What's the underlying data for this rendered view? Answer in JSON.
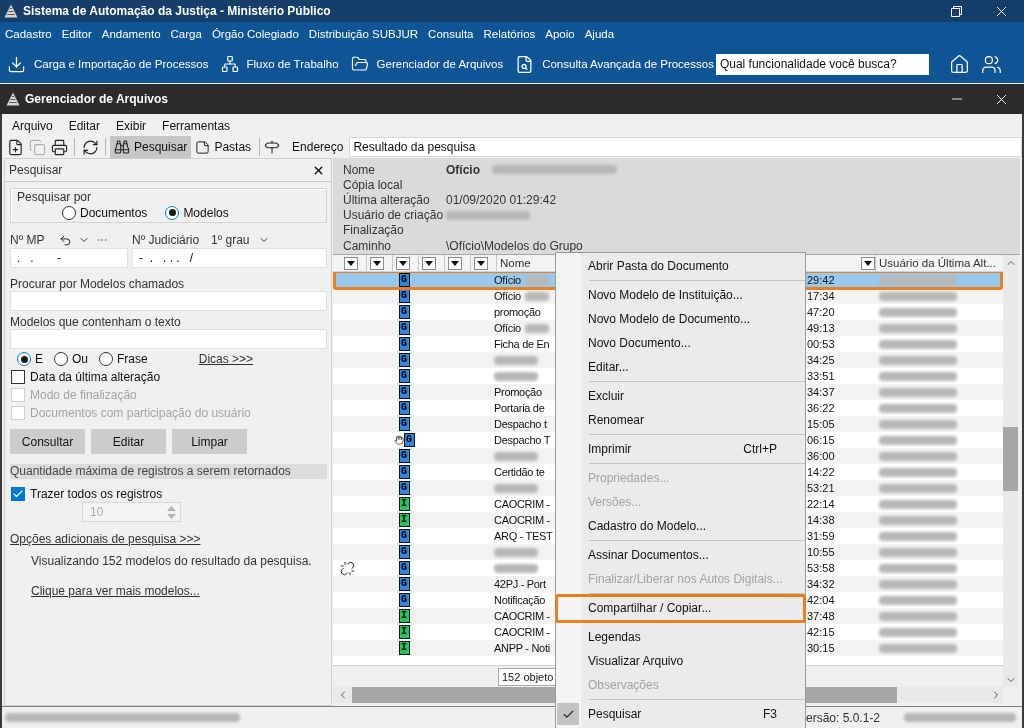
{
  "window": {
    "title": "Sistema de Automação da Justiça - Ministério Público"
  },
  "main_menu": [
    "Cadastro",
    "Editor",
    "Andamento",
    "Carga",
    "Órgão Colegiado",
    "Distribuição SUBJUR",
    "Consulta",
    "Relatórios",
    "Apoio",
    "Ajuda"
  ],
  "toolbar": {
    "items": [
      {
        "kind": "import",
        "label": "Carga e Importação de Processos"
      },
      {
        "kind": "workflow",
        "label": "Fluxo de Trabalho"
      },
      {
        "kind": "files",
        "label": "Gerenciador de Arquivos"
      },
      {
        "kind": "search",
        "label": "Consulta Avançada de Processos"
      }
    ],
    "search": {
      "placeholder": "Qual funcionalidade você busca?"
    }
  },
  "file_manager": {
    "title": "Gerenciador de Arquivos",
    "menu": [
      "Arquivo",
      "Editar",
      "Exibir",
      "Ferramentas"
    ],
    "toolbar": {
      "buttons": [
        {
          "kind": "new",
          "disabled": false
        },
        {
          "kind": "copy",
          "disabled": true
        },
        {
          "kind": "print",
          "disabled": false
        },
        {
          "kind": "refresh",
          "disabled": false
        }
      ],
      "tabs": [
        {
          "kind": "search",
          "label": "Pesquisar",
          "selected": true
        },
        {
          "kind": "folders",
          "label": "Pastas",
          "selected": false
        }
      ],
      "address_label": "Endereço",
      "address": "Resultado da pesquisa"
    }
  },
  "search_panel": {
    "title": "Pesquisar",
    "search_by": {
      "label": "Pesquisar por",
      "options": [
        {
          "label": "Documentos",
          "selected": false
        },
        {
          "label": "Modelos",
          "selected": true
        }
      ]
    },
    "mp": {
      "label": "Nº MP",
      "value": ".   .       -"
    },
    "judicial": {
      "label": "Nº Judiciário",
      "degree": "1º grau",
      "value": "-  .   . . .   /"
    },
    "name_query": {
      "label": "Procurar por Modelos chamados"
    },
    "text_query": {
      "label": "Modelos que contenham o texto"
    },
    "match": [
      {
        "label": "E",
        "selected": true
      },
      {
        "label": "Ou",
        "selected": false
      },
      {
        "label": "Frase",
        "selected": false
      }
    ],
    "tips_link": "Dicas >>>",
    "filters": [
      {
        "label": "Data da última alteração",
        "checked": false,
        "disabled": false
      },
      {
        "label": "Modo de finalização",
        "checked": false,
        "disabled": true
      },
      {
        "label": "Documentos com participação do usuário",
        "checked": false,
        "disabled": true
      }
    ],
    "buttons": [
      "Consultar",
      "Editar",
      "Limpar"
    ],
    "limit_heading": "Quantidade máxima de registros a serem retornados",
    "fetch_all": {
      "label": "Trazer todos os registros",
      "checked": true
    },
    "limit": {
      "value": "10",
      "disabled": true
    },
    "more_options_link": "Opções adicionais de pesquisa >>>",
    "summary": "Visualizando 152 modelos do resultado da pesquisa.",
    "more_link": "Clique para ver mais modelos..."
  },
  "details": [
    {
      "kind": "title",
      "label": "Nome",
      "value": "Ofício",
      "redacted": true
    },
    {
      "kind": "field",
      "label": "Cópia local",
      "redacted": false
    },
    {
      "kind": "field",
      "label": "Última alteração",
      "value": "01/09/2020 01:29:42",
      "redacted": false
    },
    {
      "kind": "field",
      "label": "Usuário de criação",
      "redacted": true
    },
    {
      "kind": "field",
      "label": "Finalização",
      "redacted": false
    },
    {
      "kind": "field",
      "label": "Caminho",
      "value": "\\Ofício\\Modelos do Grupo",
      "redacted": false
    }
  ],
  "table": {
    "columns": [
      {
        "label": "Nome"
      },
      {
        "label": "Usuário da Última Alt..."
      }
    ],
    "user_redacted": true,
    "rows": [
      {
        "kind": "plain",
        "badge": "G",
        "color": "#2f86dd",
        "name": "Ofício",
        "name_redacted": true,
        "time": "29:42",
        "selected": true,
        "highlighted": true
      },
      {
        "kind": "plain",
        "badge": "G",
        "color": "#2f86dd",
        "name": "Ofício",
        "name_redacted": true,
        "time": "17:34",
        "selected": false,
        "highlighted": false
      },
      {
        "kind": "plain",
        "badge": "G",
        "color": "#2f86dd",
        "name": "promoção",
        "name_redacted": false,
        "time": "47:20",
        "selected": false,
        "highlighted": false
      },
      {
        "kind": "plain",
        "badge": "G",
        "color": "#2f86dd",
        "name": "Ofício",
        "name_redacted": true,
        "time": "49:13",
        "selected": false,
        "highlighted": false
      },
      {
        "kind": "plain",
        "badge": "G",
        "color": "#2f86dd",
        "name": "Ficha de En",
        "name_redacted": false,
        "time": "00:53",
        "selected": false,
        "highlighted": false
      },
      {
        "kind": "plain",
        "badge": "G",
        "color": "#2f86dd",
        "name_redacted": true,
        "time": "34:25",
        "selected": false,
        "highlighted": false
      },
      {
        "kind": "plain",
        "badge": "G",
        "color": "#2f86dd",
        "name_redacted": true,
        "time": "33:51",
        "selected": false,
        "highlighted": false
      },
      {
        "kind": "plain",
        "badge": "G",
        "color": "#2f86dd",
        "name": "Promoção",
        "name_redacted": false,
        "time": "34:37",
        "selected": false,
        "highlighted": false
      },
      {
        "kind": "plain",
        "badge": "G",
        "color": "#2f86dd",
        "name": "Portaria de",
        "name_redacted": false,
        "time": "36:22",
        "selected": false,
        "highlighted": false
      },
      {
        "kind": "plain",
        "badge": "G",
        "color": "#2f86dd",
        "name": "Despacho t",
        "name_redacted": false,
        "time": "15:05",
        "selected": false,
        "highlighted": false
      },
      {
        "kind": "shared",
        "badge": "G",
        "color": "#2f86dd",
        "name": "Despacho T",
        "name_redacted": false,
        "time": "06:15",
        "selected": false,
        "highlighted": false
      },
      {
        "kind": "plain",
        "badge": "G",
        "color": "#2f86dd",
        "name_redacted": true,
        "time": "36:00",
        "selected": false,
        "highlighted": false
      },
      {
        "kind": "plain",
        "badge": "G",
        "color": "#2f86dd",
        "name": "Certidão te",
        "name_redacted": false,
        "time": "14:22",
        "selected": false,
        "highlighted": false
      },
      {
        "kind": "plain",
        "badge": "G",
        "color": "#2f86dd",
        "name_redacted": true,
        "time": "53:21",
        "selected": false,
        "highlighted": false
      },
      {
        "kind": "plain",
        "badge": "I",
        "color": "#22c55e",
        "name": "CAOCRIM -",
        "name_redacted": false,
        "time": "22:14",
        "selected": false,
        "highlighted": false
      },
      {
        "kind": "plain",
        "badge": "I",
        "color": "#22c55e",
        "name": "CAOCRIM -",
        "name_redacted": false,
        "time": "14:38",
        "selected": false,
        "highlighted": false
      },
      {
        "kind": "plain",
        "badge": "G",
        "color": "#2f86dd",
        "name": "ARQ - TEST",
        "name_redacted": false,
        "time": "31:59",
        "selected": false,
        "highlighted": false
      },
      {
        "kind": "plain",
        "badge": "G",
        "color": "#2f86dd",
        "name_redacted": true,
        "time": "10:55",
        "selected": false,
        "highlighted": false
      },
      {
        "kind": "linked",
        "badge": "G",
        "color": "#2f86dd",
        "name_redacted": true,
        "time": "53:58",
        "selected": false,
        "highlighted": false
      },
      {
        "kind": "plain",
        "badge": "G",
        "color": "#2f86dd",
        "name": "42PJ - Port",
        "name_redacted": false,
        "time": "34:32",
        "selected": false,
        "highlighted": false
      },
      {
        "kind": "plain",
        "badge": "G",
        "color": "#2f86dd",
        "name": "Notificação",
        "name_redacted": false,
        "time": "42:04",
        "selected": false,
        "highlighted": false
      },
      {
        "kind": "plain",
        "badge": "I",
        "color": "#22c55e",
        "name": "CAOCRIM -",
        "name_redacted": false,
        "time": "37:48",
        "selected": false,
        "highlighted": false
      },
      {
        "kind": "plain",
        "badge": "I",
        "color": "#22c55e",
        "name": "CAOCRIM -",
        "name_redacted": false,
        "time": "42:15",
        "selected": false,
        "highlighted": false
      },
      {
        "kind": "plain",
        "badge": "I",
        "color": "#22c55e",
        "name": "ANPP - Noti",
        "name_redacted": false,
        "time": "30:15",
        "selected": false,
        "highlighted": false
      }
    ],
    "count": "152 objeto"
  },
  "status_bar": {
    "left_redacted": true,
    "version": "ersão: 5.0.1-2",
    "right_redacted": true
  },
  "context_menu": [
    {
      "kind": "item",
      "label": "Abrir Pasta do Documento",
      "disabled": false,
      "checked": false,
      "highlighted": false
    },
    {
      "kind": "separator"
    },
    {
      "kind": "item",
      "label": "Novo Modelo de Instituição...",
      "disabled": false,
      "checked": false,
      "highlighted": false
    },
    {
      "kind": "item",
      "label": "Novo Modelo de Documento...",
      "disabled": false,
      "checked": false,
      "highlighted": false
    },
    {
      "kind": "item",
      "label": "Novo Documento...",
      "disabled": false,
      "checked": false,
      "highlighted": false
    },
    {
      "kind": "item",
      "label": "Editar...",
      "disabled": false,
      "checked": false,
      "highlighted": false
    },
    {
      "kind": "separator"
    },
    {
      "kind": "item",
      "label": "Excluir",
      "disabled": false,
      "checked": false,
      "highlighted": false
    },
    {
      "kind": "item",
      "label": "Renomear",
      "disabled": false,
      "checked": false,
      "highlighted": false
    },
    {
      "kind": "separator"
    },
    {
      "kind": "item",
      "label": "Imprimir",
      "shortcut": "Ctrl+P",
      "disabled": false,
      "checked": false,
      "highlighted": false
    },
    {
      "kind": "separator"
    },
    {
      "kind": "item",
      "label": "Propriedades...",
      "disabled": true,
      "checked": false,
      "highlighted": false
    },
    {
      "kind": "item",
      "label": "Versões...",
      "disabled": true,
      "checked": false,
      "highlighted": false
    },
    {
      "kind": "item",
      "label": "Cadastro do Modelo...",
      "disabled": false,
      "checked": false,
      "highlighted": false
    },
    {
      "kind": "separator"
    },
    {
      "kind": "item",
      "label": "Assinar Documentos...",
      "disabled": false,
      "checked": false,
      "highlighted": false
    },
    {
      "kind": "item",
      "label": "Finalizar/Liberar nos Autos Digitais...",
      "disabled": true,
      "checked": false,
      "highlighted": false
    },
    {
      "kind": "separator"
    },
    {
      "kind": "item",
      "label": "Compartilhar / Copiar...",
      "disabled": false,
      "checked": false,
      "highlighted": true
    },
    {
      "kind": "separator"
    },
    {
      "kind": "item",
      "label": "Legendas",
      "disabled": false,
      "checked": false,
      "highlighted": false
    },
    {
      "kind": "item",
      "label": "Visualizar Arquivo",
      "disabled": false,
      "checked": false,
      "highlighted": false
    },
    {
      "kind": "item",
      "label": "Observações",
      "disabled": true,
      "checked": false,
      "highlighted": false
    },
    {
      "kind": "separator"
    },
    {
      "kind": "item",
      "label": "Pesquisar",
      "shortcut": "F3",
      "disabled": false,
      "checked": true,
      "highlighted": false
    }
  ]
}
